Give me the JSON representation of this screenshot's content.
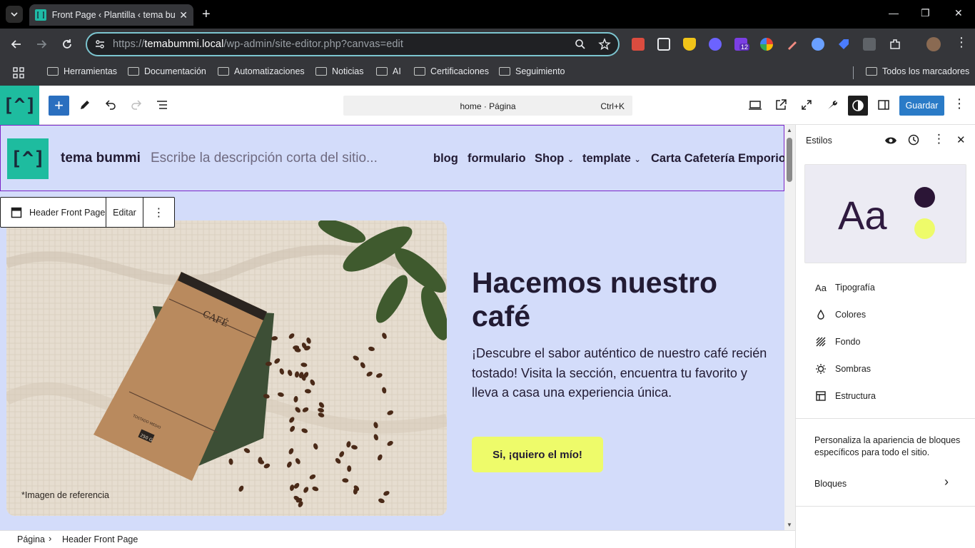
{
  "browser": {
    "tab_title": "Front Page ‹ Plantilla ‹ tema bummi",
    "url_prefix": "https://",
    "url_host": "temabummi.local",
    "url_path": "/wp-admin/site-editor.php?canvas=edit",
    "extension_badge": "12",
    "bookmarks": [
      "Herramientas",
      "Documentación",
      "Automatizaciones",
      "Noticias",
      "AI",
      "Certificaciones",
      "Seguimiento"
    ],
    "all_bookmarks": "Todos los marcadores"
  },
  "editor": {
    "command_label": "home · Página",
    "command_shortcut": "Ctrl+K",
    "save_label": "Guardar"
  },
  "site": {
    "logo_glyph": "[^]",
    "name": "tema bummi",
    "tagline_placeholder": "Escribe la descripción corta del sitio...",
    "nav": [
      "blog",
      "formulario",
      "Shop",
      "template",
      "Carta Cafetería Emporio"
    ]
  },
  "block_toolbar": {
    "block_name": "Header Front Page",
    "edit_label": "Editar"
  },
  "hero": {
    "title": "Hacemos nuestro café",
    "text": "¡Descubre el sabor auténtico de nuestro café recién tostado! Visita la sección, encuentra tu favorito y lleva a casa una experiencia única.",
    "cta": "Si, ¡quiero el mío!",
    "caption": "*Imagen de referencia",
    "bag_label": "CAFÉ",
    "bag_weight": "250 G",
    "bag_small": "TOSTADO MEDIO"
  },
  "breadcrumb": [
    "Página",
    "Header Front Page"
  ],
  "sidebar": {
    "title": "Estilos",
    "preview_text": "Aa",
    "items": [
      {
        "label": "Tipografía",
        "icon": "typography-icon"
      },
      {
        "label": "Colores",
        "icon": "drop-icon"
      },
      {
        "label": "Fondo",
        "icon": "background-icon"
      },
      {
        "label": "Sombras",
        "icon": "shadow-icon"
      },
      {
        "label": "Estructura",
        "icon": "layout-icon"
      }
    ],
    "description": "Personaliza la apariencia de bloques específicos para todo el sitio.",
    "blocks_label": "Bloques"
  },
  "colors": {
    "site_teal": "#1ebc9f",
    "canvas_bg": "#d3dcfa",
    "accent_yellow": "#eefb6a",
    "dark_text": "#221b33",
    "wp_blue": "#2a7bc7"
  }
}
